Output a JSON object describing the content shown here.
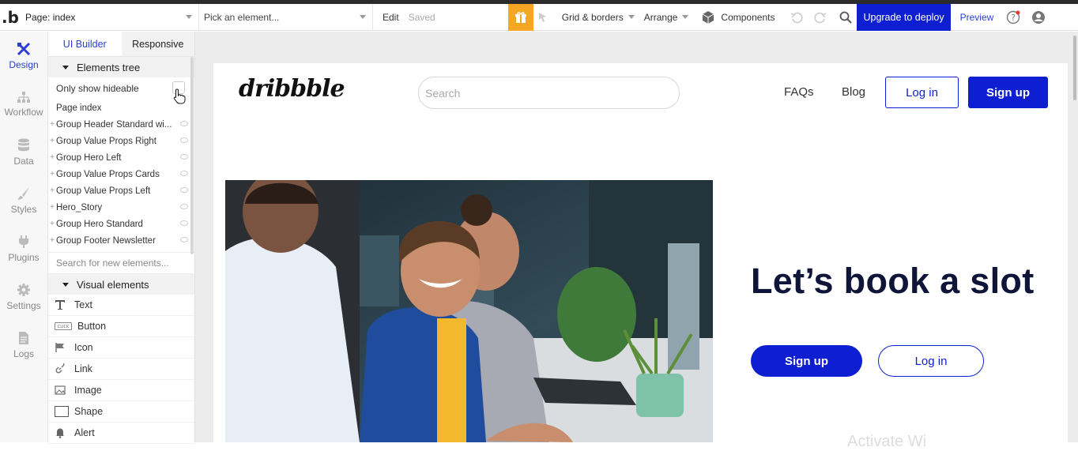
{
  "topbar": {
    "logo": ".b",
    "page_select": "Page: index",
    "element_select": "Pick an element...",
    "edit": "Edit",
    "saved": "Saved",
    "grid_borders": "Grid & borders",
    "arrange": "Arrange",
    "components": "Components",
    "upgrade": "Upgrade to deploy",
    "preview": "Preview"
  },
  "sidebar": {
    "items": [
      {
        "label": "Design",
        "icon": "design-icon"
      },
      {
        "label": "Workflow",
        "icon": "workflow-icon"
      },
      {
        "label": "Data",
        "icon": "database-icon"
      },
      {
        "label": "Styles",
        "icon": "brush-icon"
      },
      {
        "label": "Plugins",
        "icon": "plug-icon"
      },
      {
        "label": "Settings",
        "icon": "gear-icon"
      },
      {
        "label": "Logs",
        "icon": "document-icon"
      }
    ]
  },
  "panel": {
    "tabs": [
      "UI Builder",
      "Responsive"
    ],
    "elements_tree_title": "Elements tree",
    "only_show_hideable": "Only show hideable",
    "tree_items": [
      "Page index",
      "Group Header Standard wi...",
      "Group Value Props Right",
      "Group Hero Left",
      "Group Value Props Cards",
      "Group Value Props Left",
      "Hero_Story",
      "Group Hero Standard",
      "Group Footer Newsletter"
    ],
    "search_placeholder": "Search for new elements...",
    "visual_elements_title": "Visual elements",
    "visual_elements": [
      {
        "label": "Text",
        "icon": "text-icon"
      },
      {
        "label": "Button",
        "icon": "button-icon"
      },
      {
        "label": "Icon",
        "icon": "flag-icon"
      },
      {
        "label": "Link",
        "icon": "link-icon"
      },
      {
        "label": "Image",
        "icon": "image-icon"
      },
      {
        "label": "Shape",
        "icon": "shape-icon"
      },
      {
        "label": "Alert",
        "icon": "bell-icon"
      }
    ]
  },
  "page": {
    "brand": "dribbble",
    "search_placeholder": "Search",
    "nav": [
      "FAQs",
      "Blog"
    ],
    "login": "Log in",
    "signup": "Sign up",
    "hero_title": "Let’s book a slot",
    "hero_signup": "Sign up",
    "hero_login": "Log in",
    "watermark": "Activate Wi"
  },
  "colors": {
    "accent": "#0d1fd1",
    "gift": "#f5a623",
    "hero_title": "#0f1538"
  }
}
